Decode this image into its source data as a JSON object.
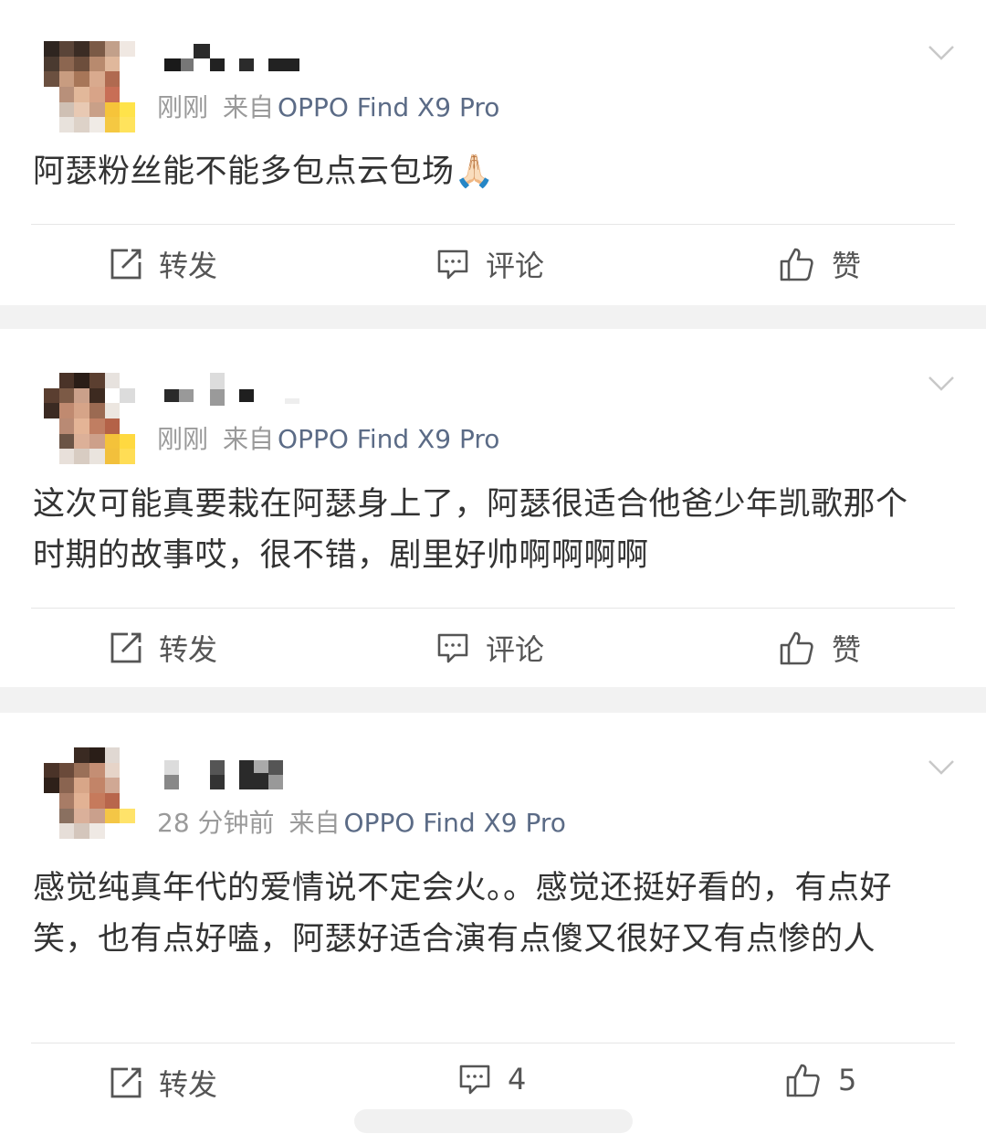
{
  "posts": [
    {
      "time": "刚刚",
      "source_prefix": "来自",
      "device": "OPPO Find X9 Pro",
      "content": "阿瑟粉丝能不能多包点云包场🙏🏻",
      "actions": {
        "repost": "转发",
        "comment": "评论",
        "like": "赞"
      }
    },
    {
      "time": "刚刚",
      "source_prefix": "来自",
      "device": "OPPO Find X9 Pro",
      "content": "这次可能真要栽在阿瑟身上了，阿瑟很适合他爸少年凯歌那个时期的故事哎，很不错，剧里好帅啊啊啊啊",
      "actions": {
        "repost": "转发",
        "comment": "评论",
        "like": "赞"
      }
    },
    {
      "time": "28 分钟前",
      "source_prefix": "来自",
      "device": "OPPO Find X9 Pro",
      "content": "感觉纯真年代的爱情说不定会火。。感觉还挺好看的，有点好笑，也有点好嗑，阿瑟好适合演有点傻又很好又有点惨的人",
      "actions": {
        "repost": "转发",
        "comment": "4",
        "like": "5"
      }
    }
  ],
  "icons": {
    "repost": "repost-icon",
    "comment": "comment-icon",
    "like": "thumbs-up-icon",
    "menu": "chevron-down-icon"
  },
  "colors": {
    "text": "#333333",
    "meta": "#9a9a9a",
    "device": "#5b6b86",
    "background": "#f2f2f2"
  }
}
